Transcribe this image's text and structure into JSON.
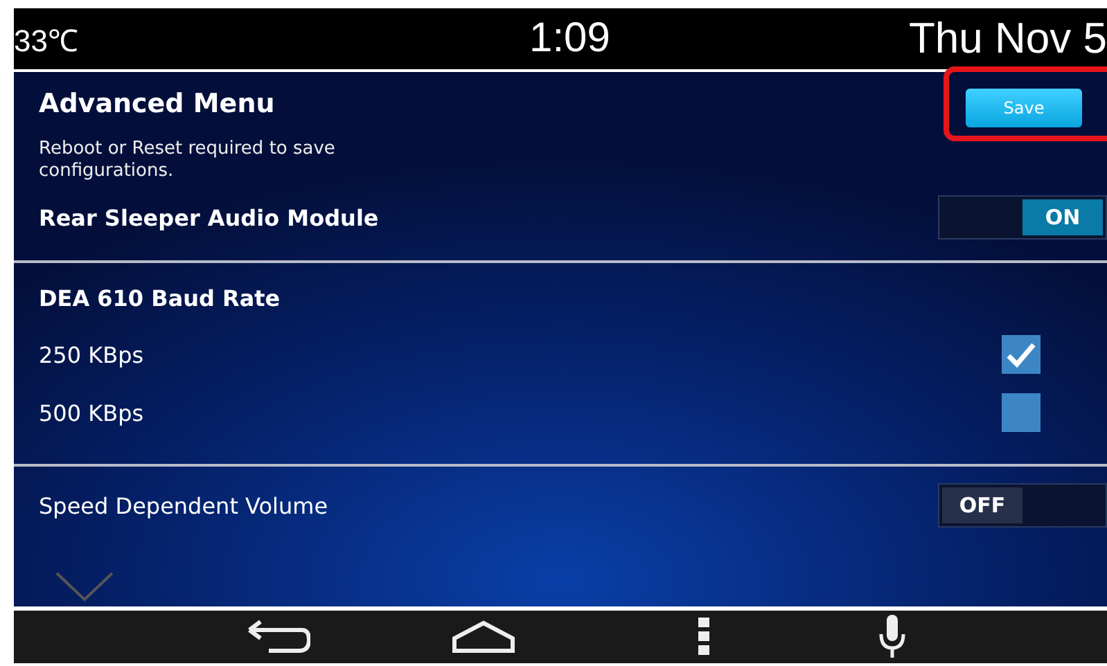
{
  "status_bar": {
    "temperature": "33℃",
    "time": "1:09",
    "date": "Thu Nov 5"
  },
  "header": {
    "title": "Advanced Menu",
    "save_button": "Save",
    "highlighted": true,
    "note": "Reboot or Reset required to save configurations."
  },
  "sections": [
    {
      "kind": "toggle",
      "label": "Rear Sleeper Audio Module",
      "on": true,
      "state_text": "ON"
    },
    {
      "kind": "options",
      "title": "DEA 610 Baud Rate",
      "options": [
        {
          "label": "250 KBps",
          "checked": true
        },
        {
          "label": "500 KBps",
          "checked": false
        }
      ]
    },
    {
      "kind": "toggle",
      "label": "Speed Dependent Volume",
      "on": false,
      "state_text": "OFF"
    }
  ]
}
